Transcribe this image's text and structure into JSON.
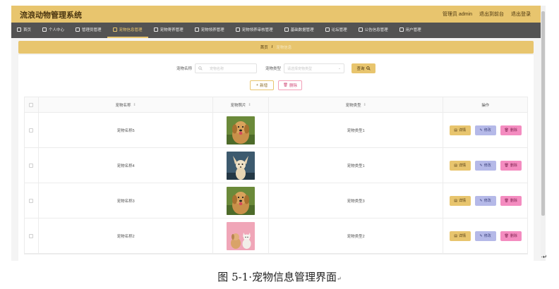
{
  "app": {
    "title": "流浪动物管理系统",
    "admin_label": "管理员 admin",
    "back_label": "退出到前台",
    "logout_label": "退出登录"
  },
  "nav": [
    {
      "label": "首页",
      "icon": "home-icon",
      "active": false
    },
    {
      "label": "个人中心",
      "icon": "user-icon",
      "active": false
    },
    {
      "label": "管理员管理",
      "icon": "admin-icon",
      "active": false
    },
    {
      "label": "宠物信息管理",
      "icon": "pet-info-icon",
      "active": true
    },
    {
      "label": "宠物寄养管理",
      "icon": "foster-icon",
      "active": false
    },
    {
      "label": "宠物领养管理",
      "icon": "adopt-icon",
      "active": false
    },
    {
      "label": "宠物领养审核管理",
      "icon": "audit-icon",
      "active": false
    },
    {
      "label": "基础数据管理",
      "icon": "data-icon",
      "active": false
    },
    {
      "label": "论坛管理",
      "icon": "forum-icon",
      "active": false
    },
    {
      "label": "公告信息管理",
      "icon": "notice-icon",
      "active": false
    },
    {
      "label": "用户管理",
      "icon": "users-icon",
      "active": false
    }
  ],
  "breadcrumb": {
    "home": "首页",
    "separator": "/",
    "current": "宠物信息"
  },
  "search": {
    "name_label": "宠物名称",
    "name_placeholder": "宠物名称",
    "type_label": "宠物类型",
    "type_placeholder": "请选择宠物类型",
    "search_button": "查询"
  },
  "actions": {
    "add": "新增",
    "delete": "删除"
  },
  "table": {
    "headers": {
      "name": "宠物名称",
      "photo": "宠物照片",
      "type": "宠物类型",
      "ops": "操作"
    },
    "rows": [
      {
        "name": "宠物名称5",
        "type": "宠物类型1",
        "photo": "golden-retriever"
      },
      {
        "name": "宠物名称4",
        "type": "宠物类型1",
        "photo": "chihuahua"
      },
      {
        "name": "宠物名称3",
        "type": "宠物类型3",
        "photo": "golden-retriever"
      },
      {
        "name": "宠物名称2",
        "type": "宠物类型2",
        "photo": "dog-and-cat"
      }
    ],
    "op_labels": {
      "detail": "详情",
      "edit": "修改",
      "remove": "删除"
    }
  },
  "caption": {
    "text": "图 5-1·宠物信息管理界面",
    "mark": "↵"
  },
  "colors": {
    "accent": "#e8c56e",
    "nav_bg": "#535353",
    "detail": "#e8c56e",
    "edit": "#b5b9e8",
    "remove": "#f48cc0"
  }
}
